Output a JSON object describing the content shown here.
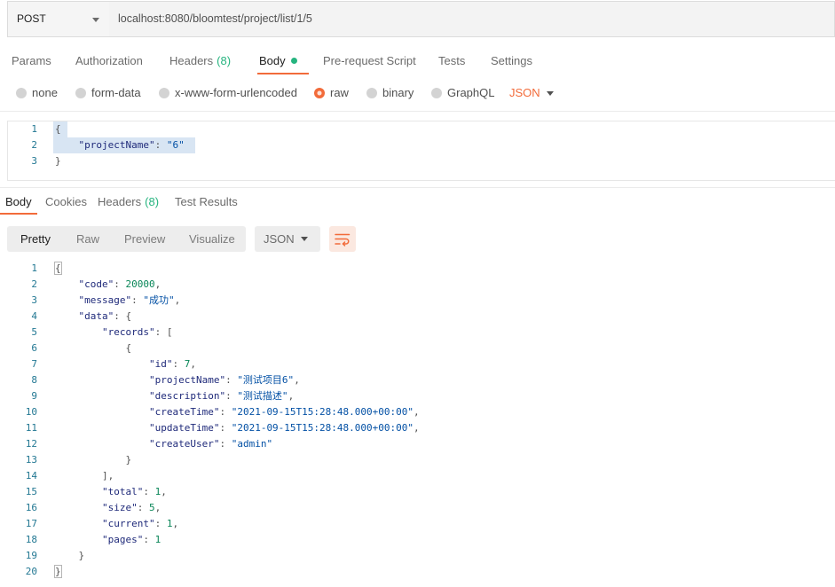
{
  "request_bar": {
    "method": "POST",
    "url": "localhost:8080/bloomtest/project/list/1/5",
    "method_dropdown_icon": "chevron-down-icon"
  },
  "request_tabs": [
    {
      "label": "Params"
    },
    {
      "label": "Authorization"
    },
    {
      "label": "Headers",
      "count": "(8)"
    },
    {
      "label": "Body",
      "active": true,
      "indicator": "dot-icon"
    },
    {
      "label": "Pre-request Script"
    },
    {
      "label": "Tests"
    },
    {
      "label": "Settings"
    }
  ],
  "body_types": {
    "options": [
      "none",
      "form-data",
      "x-www-form-urlencoded",
      "raw",
      "binary",
      "GraphQL"
    ],
    "selected": "raw",
    "format": "JSON"
  },
  "request_body": [
    {
      "n": 1,
      "text": "{"
    },
    {
      "n": 2,
      "text": "    \"projectName\": \"6\""
    },
    {
      "n": 3,
      "text": "}"
    }
  ],
  "response_tabs": [
    {
      "label": "Body",
      "active": true
    },
    {
      "label": "Cookies"
    },
    {
      "label": "Headers",
      "count": "(8)"
    },
    {
      "label": "Test Results"
    }
  ],
  "response_toolbar": {
    "view_modes": [
      "Pretty",
      "Raw",
      "Preview",
      "Visualize"
    ],
    "active_mode": "Pretty",
    "format": "JSON",
    "wrap_icon": "wrap-lines-icon"
  },
  "response_body": [
    {
      "n": 1,
      "text": "{"
    },
    {
      "n": 2,
      "text": "    \"code\": 20000,"
    },
    {
      "n": 3,
      "text": "    \"message\": \"成功\","
    },
    {
      "n": 4,
      "text": "    \"data\": {"
    },
    {
      "n": 5,
      "text": "        \"records\": ["
    },
    {
      "n": 6,
      "text": "            {"
    },
    {
      "n": 7,
      "text": "                \"id\": 7,"
    },
    {
      "n": 8,
      "text": "                \"projectName\": \"测试项目6\","
    },
    {
      "n": 9,
      "text": "                \"description\": \"测试描述\","
    },
    {
      "n": 10,
      "text": "                \"createTime\": \"2021-09-15T15:28:48.000+00:00\","
    },
    {
      "n": 11,
      "text": "                \"updateTime\": \"2021-09-15T15:28:48.000+00:00\","
    },
    {
      "n": 12,
      "text": "                \"createUser\": \"admin\""
    },
    {
      "n": 13,
      "text": "            }"
    },
    {
      "n": 14,
      "text": "        ],"
    },
    {
      "n": 15,
      "text": "        \"total\": 1,"
    },
    {
      "n": 16,
      "text": "        \"size\": 5,"
    },
    {
      "n": 17,
      "text": "        \"current\": 1,"
    },
    {
      "n": 18,
      "text": "        \"pages\": 1"
    },
    {
      "n": 19,
      "text": "    }"
    },
    {
      "n": 20,
      "text": "}"
    }
  ],
  "colors": {
    "accent": "#f26b3a",
    "success": "#26b47f",
    "json_key": "#1f2a7a",
    "json_string": "#0451a5",
    "json_number": "#098658",
    "line_number": "#237893"
  }
}
